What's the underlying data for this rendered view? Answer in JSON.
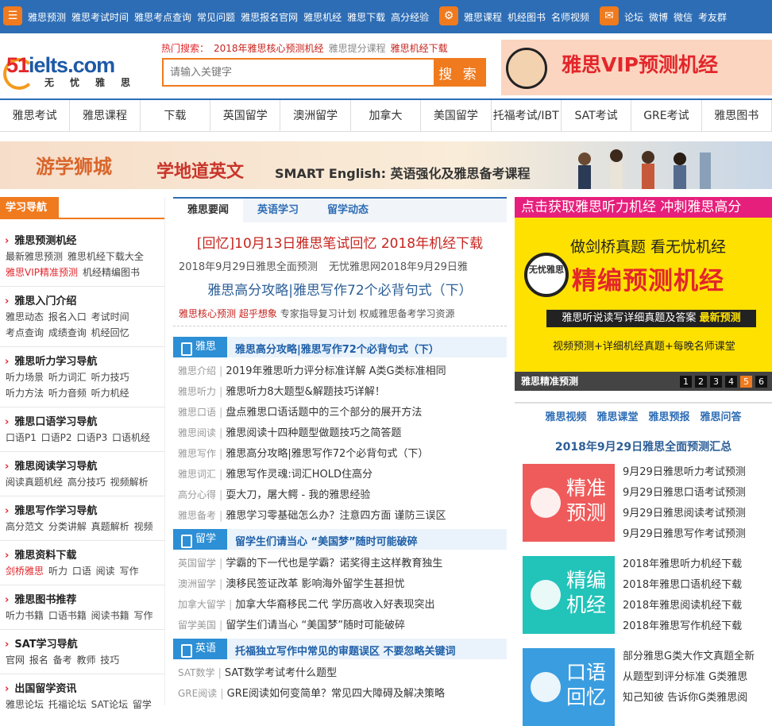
{
  "topbar": {
    "group1": [
      "雅思预测",
      "雅思考试时间",
      "雅思考点查询",
      "常见问题",
      "雅思报名官网",
      "雅思机经",
      "雅思下载",
      "高分经验"
    ],
    "group2": [
      "雅思课程",
      "机经图书",
      "名师视频"
    ],
    "group3": [
      "论坛",
      "微博",
      "微信",
      "考友群"
    ]
  },
  "logo": {
    "main_a": "51",
    "main_b": "ielts.com",
    "sub": "无忧雅思"
  },
  "hot": {
    "label": "热门搜索：",
    "links": [
      "2018年雅思核心预测机经",
      "雅思提分课程",
      "雅思机经下载"
    ]
  },
  "search": {
    "placeholder": "请输入关键字",
    "button": "搜 索"
  },
  "vip_banner": "雅思VIP预测机经",
  "nav": [
    "雅思考试",
    "雅思课程",
    "下载",
    "英国留学",
    "澳洲留学",
    "加拿大",
    "美国留学",
    "托福考试/IBT",
    "SAT考试",
    "GRE考试",
    "雅思图书"
  ],
  "banner": {
    "t1": "游学狮城",
    "t2": "学地道英文",
    "t3": "SMART English: 英语强化及雅思备考课程"
  },
  "left": {
    "head": "学习导航",
    "sections": [
      {
        "title": "雅思预测机经",
        "l1": "最新雅思预测 雅思机经下载大全",
        "l2a": "雅思VIP精准预测",
        "l2b": "机经精编图书"
      },
      {
        "title": "雅思入门介绍",
        "l1": "雅思动态 报名入口 考试时间",
        "l2a": "",
        "l2b": "考点查询 成绩查询 机经回忆"
      },
      {
        "title": "雅思听力学习导航",
        "l1": "听力场景 听力词汇 听力技巧",
        "l2a": "",
        "l2b": "听力方法 听力音频 听力机经"
      },
      {
        "title": "雅思口语学习导航",
        "l1": "口语P1 口语P2 口语P3 口语机经",
        "l2a": "",
        "l2b": ""
      },
      {
        "title": "雅思阅读学习导航",
        "l1": "阅读真题机经 高分技巧 视频解析",
        "l2a": "",
        "l2b": ""
      },
      {
        "title": "雅思写作学习导航",
        "l1": "高分范文 分类讲解 真题解析 视频",
        "l2a": "",
        "l2b": ""
      },
      {
        "title": "雅思资料下载",
        "l1": "",
        "l2a": "剑桥雅思",
        "l2b": "听力 口语 阅读 写作"
      },
      {
        "title": "雅思图书推荐",
        "l1": "听力书籍 口语书籍 阅读书籍 写作",
        "l2a": "",
        "l2b": ""
      },
      {
        "title": "SAT学习导航",
        "l1": "官网 报名 备考 教师 技巧",
        "l2a": "",
        "l2b": ""
      },
      {
        "title": "出国留学资讯",
        "l1": "雅思论坛 托福论坛 SAT论坛 留学",
        "l2a": "",
        "l2b": ""
      }
    ]
  },
  "mid": {
    "tabs": [
      "雅思要闻",
      "英语学习",
      "留学动态"
    ],
    "headline1": "[回忆]10月13日雅思笔试回忆 2018年机经下载",
    "headline2": "2018年9月29日雅思全面预测 无忧雅思网2018年9月29日雅",
    "headline3": "雅思高分攻略|雅思写作72个必背句式（下）",
    "hot_a": "雅思核心预测",
    "hot_b": "超乎想象",
    "hot_c": "专家指导复习计划 权威雅思备考学习资源",
    "sections": [
      {
        "tag": "雅思",
        "title": "雅思高分攻略|雅思写作72个必背句式（下）",
        "items": [
          [
            "雅思介绍",
            "2019年雅思听力评分标准详解 A类G类标准相同"
          ],
          [
            "雅思听力",
            "雅思听力8大题型&解题技巧详解！"
          ],
          [
            "雅思口语",
            "盘点雅思口语话题中的三个部分的展开方法"
          ],
          [
            "雅思阅读",
            "雅思阅读十四种题型做题技巧之简答题"
          ],
          [
            "雅思写作",
            "雅思高分攻略|雅思写作72个必背句式（下）"
          ],
          [
            "雅思词汇",
            "雅思写作灵魂:词汇HOLD住高分"
          ],
          [
            "高分心得",
            "耍大刀，屠大鳄 - 我的雅思经验"
          ],
          [
            "雅思备考",
            "雅思学习零基础怎么办？注意四方面 谨防三误区"
          ]
        ]
      },
      {
        "tag": "留学",
        "title": "留学生们请当心 “美国梦”随时可能破碎",
        "items": [
          [
            "英国留学",
            "学霸的下一代也是学霸？诺奖得主这样教育独生"
          ],
          [
            "澳洲留学",
            "澳移民签证改革 影响海外留学生甚担忧"
          ],
          [
            "加拿大留学",
            "加拿大华裔移民二代 学历高收入好表现突出"
          ],
          [
            "留学美国",
            "留学生们请当心 “美国梦”随时可能破碎"
          ]
        ]
      },
      {
        "tag": "英语",
        "title": "托福独立写作中常见的审题误区 不要忽略关键词",
        "items": [
          [
            "SAT数学",
            "SAT数学考试考什么题型"
          ],
          [
            "GRE阅读",
            "GRE阅读如何变简单？常见四大障碍及解决策略"
          ]
        ]
      }
    ]
  },
  "right": {
    "top_banner": "点击获取雅思听力机经 冲刺雅思高分",
    "yellow_l1": "做剑桥真题 看无忧机经",
    "circle": "无忧雅思",
    "yellow_l2": "精编预测机经",
    "yellow_l3a": "雅思听说读写详细真题及答案 ",
    "yellow_l3b": "最新预测",
    "yellow_l4": "视频预测+详细机经真题+每晚名师课堂",
    "dark": "雅思精准预测",
    "pager": [
      "1",
      "2",
      "3",
      "4",
      "5",
      "6"
    ],
    "tabs": [
      "雅思视频",
      "雅思课堂",
      "雅思预报",
      "雅思问答"
    ],
    "subtitle": "2018年9月29日雅思全面预测汇总",
    "tiles": [
      {
        "text": "精准预测",
        "color": "#ef5b5b",
        "links": [
          "9月29日雅思听力考试预测",
          "9月29日雅思口语考试预测",
          "9月29日雅思阅读考试预测",
          "9月29日雅思写作考试预测"
        ]
      },
      {
        "text": "精编机经",
        "color": "#22c3b9",
        "links": [
          "2018年雅思听力机经下载",
          "2018年雅思口语机经下载",
          "2018年雅思阅读机经下载",
          "2018年雅思写作机经下载"
        ]
      },
      {
        "text": "口语回忆",
        "color": "#3a9de0",
        "links": [
          "部分雅思G类大作文真题全新",
          "从题型到评分标准 G类雅思",
          "知己知彼 告诉你G类雅思阅"
        ]
      }
    ]
  },
  "colors": {
    "primary": "#2d6db5",
    "accent": "#f07a1e",
    "red": "#e3262b",
    "pink": "#e61f7c",
    "yellow": "#ffe100"
  }
}
